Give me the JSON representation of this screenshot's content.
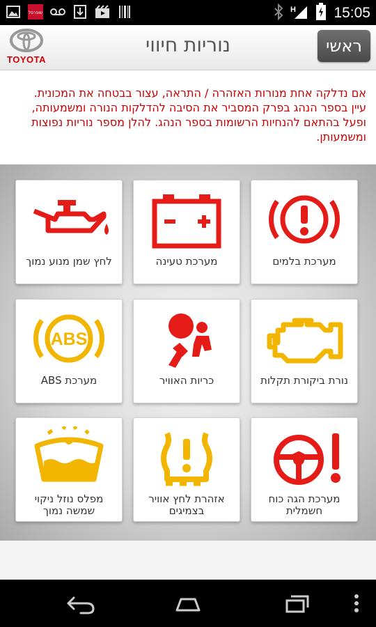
{
  "status_bar": {
    "time": "15:05",
    "left_icons": [
      "image-icon",
      "app-icon",
      "voicemail-icon",
      "download-icon",
      "video-icon",
      "barcode-icon"
    ],
    "right_icons": [
      "bluetooth-icon",
      "signal-icon",
      "battery-icon"
    ],
    "app_badge_text": "שופרסל"
  },
  "header": {
    "logo_text": "TOYOTA",
    "title": "נוריות חיווי",
    "home_label": "ראשי"
  },
  "intro": {
    "text": "אם נדלקה אחת מנורות האזהרה / התראה, עצור בבטחה את המכונית. עיין בספר הנהג בפרק המסביר את הסיבה להדלקות הנורה ומשמעותה, ופעל בהתאם להנחיות הרשומות בספר הנהג. להלן מספר נוריות נפוצות ומשמעותן."
  },
  "colors": {
    "red": "#e41b17",
    "amber": "#f2b500",
    "intro_text": "#cc0000"
  },
  "tiles": [
    {
      "label": "מערכת בלמים",
      "icon": "brake-warning-icon"
    },
    {
      "label": "מערכת טעינה",
      "icon": "battery-charge-icon"
    },
    {
      "label": "לחץ שמן מנוע נמוך",
      "icon": "oil-pressure-icon"
    },
    {
      "label": "נורת ביקורת תקלות",
      "icon": "check-engine-icon"
    },
    {
      "label": "כריות האוויר",
      "icon": "airbag-icon"
    },
    {
      "label": "מערכת ABS",
      "icon": "abs-icon",
      "icon_text": "ABS"
    },
    {
      "label": "מערכת הגה כוח חשמלית",
      "icon": "power-steering-icon"
    },
    {
      "label": "אזהרת לחץ אוויר בצמיגים",
      "icon": "tire-pressure-icon"
    },
    {
      "label": "מפלס נוזל ניקוי שמשה נמוך",
      "icon": "washer-fluid-icon"
    }
  ]
}
